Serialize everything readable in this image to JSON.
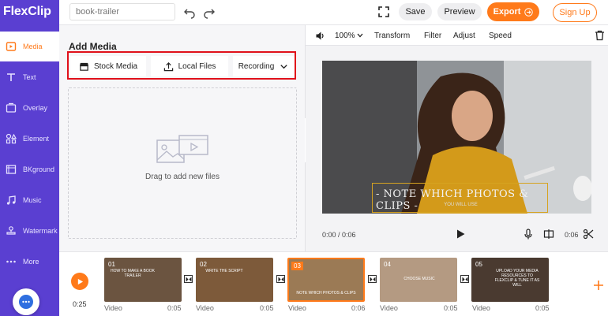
{
  "app": {
    "logo_f": "F",
    "logo_rest": "lexClip"
  },
  "sidebar": {
    "items": [
      {
        "label": "Media",
        "icon": "media-icon",
        "active": true
      },
      {
        "label": "Text",
        "icon": "text-icon"
      },
      {
        "label": "Overlay",
        "icon": "overlay-icon"
      },
      {
        "label": "Element",
        "icon": "element-icon"
      },
      {
        "label": "BKground",
        "icon": "background-icon"
      },
      {
        "label": "Music",
        "icon": "music-icon"
      },
      {
        "label": "Watermark",
        "icon": "watermark-icon"
      },
      {
        "label": "More",
        "icon": "more-icon"
      }
    ]
  },
  "topbar": {
    "project_name": "book-trailer",
    "save_label": "Save",
    "preview_label": "Preview",
    "export_label": "Export",
    "signup_label": "Sign Up"
  },
  "media": {
    "title": "Add Media",
    "tabs": [
      {
        "label": "Stock Media",
        "icon": "store-icon"
      },
      {
        "label": "Local Files",
        "icon": "upload-icon"
      },
      {
        "label": "Recording",
        "icon": "chevron-down-icon"
      }
    ],
    "drop_text": "Drag to add new files"
  },
  "preview": {
    "zoom": "100%",
    "tools": [
      "Transform",
      "Filter",
      "Adjust",
      "Speed"
    ],
    "overlay_title": "- NOTE WHICH PHOTOS & CLIPS -",
    "overlay_sub": "YOU WILL USE",
    "time": "0:00 / 0:06",
    "duration": "0:06"
  },
  "timeline": {
    "current_time": "0:25",
    "clips": [
      {
        "num": "01",
        "caption": "HOW TO MAKE A BOOK TRAILER",
        "type": "Video",
        "duration": "0:05",
        "color": "#6b5440"
      },
      {
        "num": "02",
        "caption": "WRITE THE SCRIPT",
        "type": "Video",
        "duration": "0:05",
        "color": "#7d5a3a"
      },
      {
        "num": "03",
        "caption": "NOTE WHICH PHOTOS & CLIPS",
        "type": "Video",
        "duration": "0:06",
        "color": "#9b7a55",
        "selected": true
      },
      {
        "num": "04",
        "caption": "CHOOSE MUSIC",
        "type": "Video",
        "duration": "0:05",
        "color": "#b49a82"
      },
      {
        "num": "05",
        "caption": "UPLOAD YOUR MEDIA RESOURCES TO FLEXCLIP & TUNE IT AS WILL",
        "type": "Video",
        "duration": "0:05",
        "color": "#4a3a30"
      }
    ]
  },
  "colors": {
    "brand": "#5a3fd1",
    "accent": "#ff7a1a",
    "highlight": "#e0101a"
  }
}
